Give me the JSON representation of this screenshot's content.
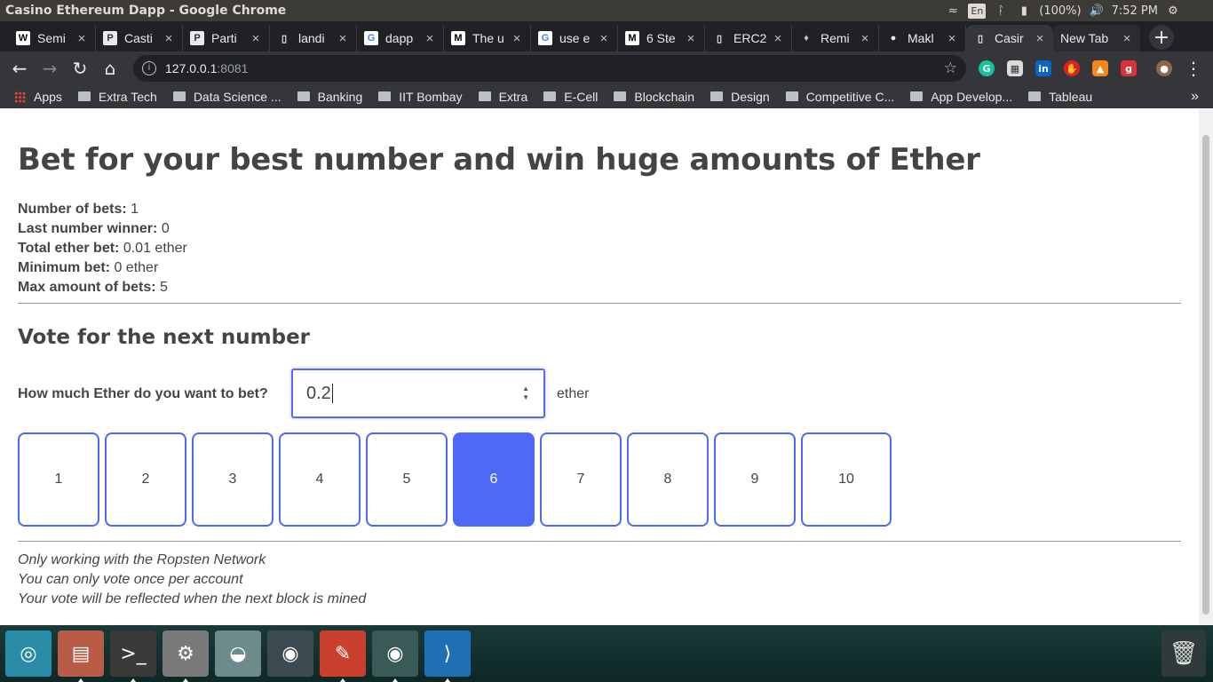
{
  "system": {
    "window_title": "Casino Ethereum Dapp - Google Chrome",
    "lang": "En",
    "battery": "(100%)",
    "time": "7:52 PM"
  },
  "tabs": [
    {
      "label": "Semi",
      "favicon": "W"
    },
    {
      "label": "Casti",
      "favicon": "P"
    },
    {
      "label": "Parti",
      "favicon": "P"
    },
    {
      "label": "landi",
      "favicon": "doc"
    },
    {
      "label": "dapp",
      "favicon": "G"
    },
    {
      "label": "The u",
      "favicon": "M"
    },
    {
      "label": "use e",
      "favicon": "G"
    },
    {
      "label": "6 Ste",
      "favicon": "M"
    },
    {
      "label": "ERC2",
      "favicon": "doc"
    },
    {
      "label": "Remi",
      "favicon": "eth"
    },
    {
      "label": "Makl",
      "favicon": "gh"
    },
    {
      "label": "Casir",
      "favicon": "doc",
      "active": true
    },
    {
      "label": "New Tab",
      "favicon": ""
    }
  ],
  "address_bar": {
    "host": "127.0.0.1",
    "port": ":8081"
  },
  "bookmarks": [
    {
      "label": "Apps",
      "kind": "apps"
    },
    {
      "label": "Extra Tech",
      "kind": "folder"
    },
    {
      "label": "Data Science ...",
      "kind": "folder"
    },
    {
      "label": "Banking",
      "kind": "folder"
    },
    {
      "label": "IIT Bombay",
      "kind": "folder"
    },
    {
      "label": "Extra",
      "kind": "folder"
    },
    {
      "label": "E-Cell",
      "kind": "folder"
    },
    {
      "label": "Blockchain",
      "kind": "folder"
    },
    {
      "label": "Design",
      "kind": "folder"
    },
    {
      "label": "Competitive C...",
      "kind": "folder"
    },
    {
      "label": "App Develop...",
      "kind": "folder"
    },
    {
      "label": "Tableau",
      "kind": "folder"
    }
  ],
  "page": {
    "heading": "Bet for your best number and win huge amounts of Ether",
    "stats": [
      {
        "label": "Number of bets:",
        "value": "1"
      },
      {
        "label": "Last number winner:",
        "value": "0"
      },
      {
        "label": "Total ether bet:",
        "value": "0.01 ether"
      },
      {
        "label": "Minimum bet:",
        "value": "0 ether"
      },
      {
        "label": "Max amount of bets:",
        "value": "5"
      }
    ],
    "vote_heading": "Vote for the next number",
    "bet_question": "How much Ether do you want to bet?",
    "bet_value": "0.2",
    "bet_unit": "ether",
    "numbers": [
      "1",
      "2",
      "3",
      "4",
      "5",
      "6",
      "7",
      "8",
      "9",
      "10"
    ],
    "selected_number": "6",
    "notes": [
      "Only working with the Ropsten Network",
      "You can only vote once per account",
      "Your vote will be reflected when the next block is mined"
    ]
  },
  "colors": {
    "accent": "#4e68f7",
    "text": "#444444",
    "chrome_dark": "#202124",
    "chrome_toolbar": "#35363a"
  },
  "launcher": [
    {
      "name": "ubuntu-icon"
    },
    {
      "name": "files-icon"
    },
    {
      "name": "terminal-icon"
    },
    {
      "name": "settings-icon"
    },
    {
      "name": "disk-icon"
    },
    {
      "name": "blender-icon"
    },
    {
      "name": "document-viewer-icon"
    },
    {
      "name": "chrome-icon"
    },
    {
      "name": "vscode-icon"
    }
  ]
}
